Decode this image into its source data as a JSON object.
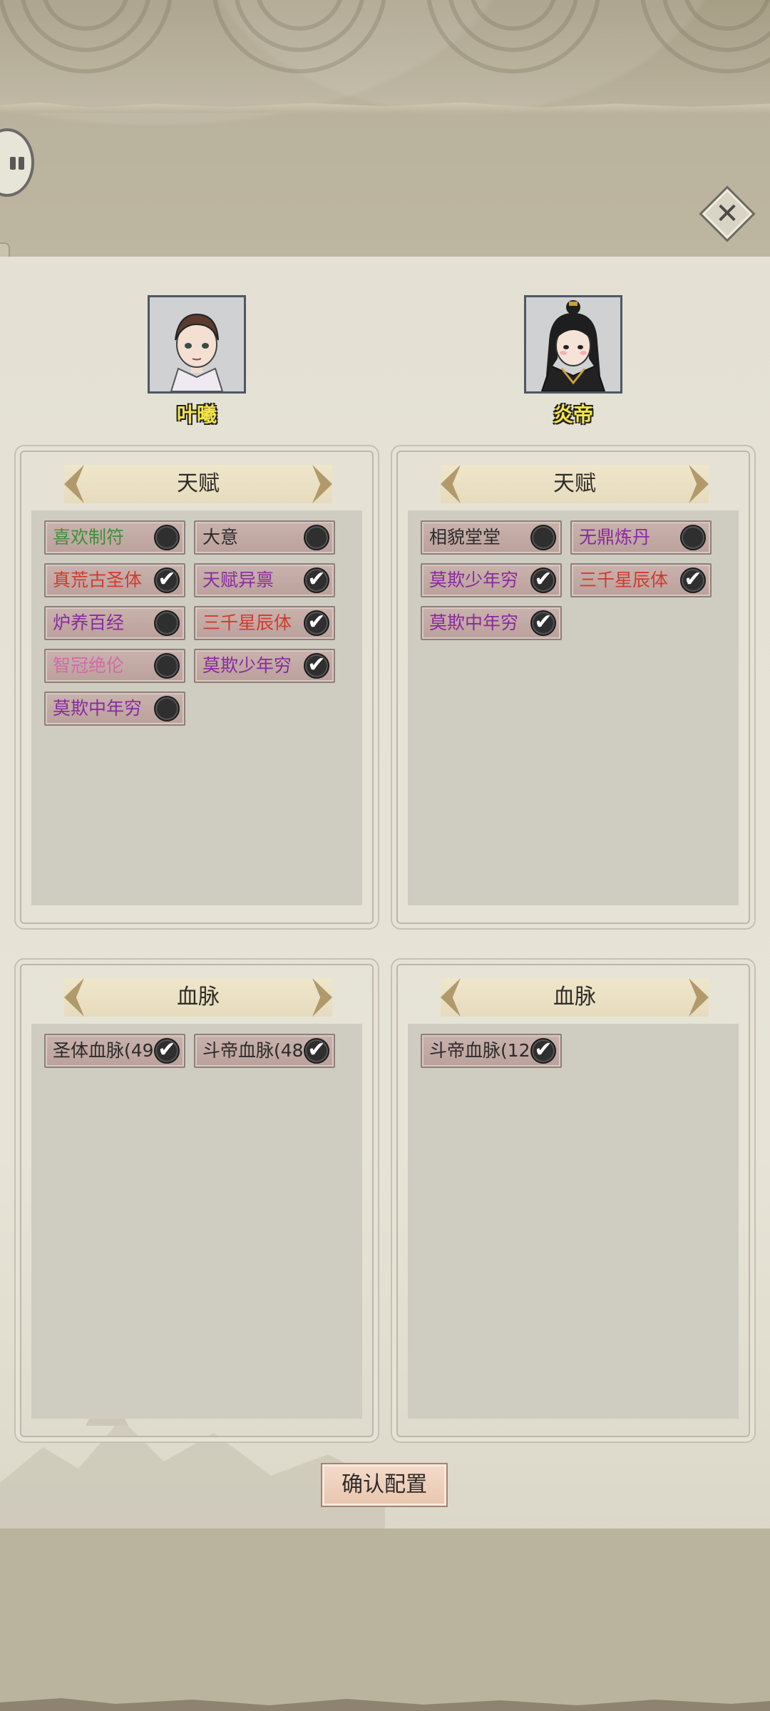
{
  "characters": [
    {
      "name": "叶曦"
    },
    {
      "name": "炎帝"
    }
  ],
  "sections": {
    "talent_title": "天赋",
    "bloodline_title": "血脉"
  },
  "left_talents": [
    {
      "label": "喜欢制符",
      "color": "#3f8f3a",
      "checked": false
    },
    {
      "label": "大意",
      "color": "#2b2b2b",
      "checked": false
    },
    {
      "label": "真荒古圣体",
      "color": "#d23b2f",
      "checked": true
    },
    {
      "label": "天赋异禀",
      "color": "#8a2aa0",
      "checked": true
    },
    {
      "label": "炉养百经",
      "color": "#8a2aa0",
      "checked": false
    },
    {
      "label": "三千星辰体",
      "color": "#d23b2f",
      "checked": true
    },
    {
      "label": "智冠绝伦",
      "color": "#d36aa8",
      "checked": false
    },
    {
      "label": "莫欺少年穷",
      "color": "#8a2aa0",
      "checked": true
    },
    {
      "label": "莫欺中年穷",
      "color": "#8a2aa0",
      "checked": false
    }
  ],
  "right_talents": [
    {
      "label": "相貌堂堂",
      "color": "#2b2b2b",
      "checked": false
    },
    {
      "label": "无鼎炼丹",
      "color": "#8a2aa0",
      "checked": false
    },
    {
      "label": "莫欺少年穷",
      "color": "#8a2aa0",
      "checked": true
    },
    {
      "label": "三千星辰体",
      "color": "#d23b2f",
      "checked": true
    },
    {
      "label": "莫欺中年穷",
      "color": "#8a2aa0",
      "checked": true
    }
  ],
  "left_bloodlines": [
    {
      "label": "圣体血脉(49",
      "color": "#2b2b2b",
      "checked": true
    },
    {
      "label": "斗帝血脉(48",
      "color": "#2b2b2b",
      "checked": true
    }
  ],
  "right_bloodlines": [
    {
      "label": "斗帝血脉(12",
      "color": "#2b2b2b",
      "checked": true
    }
  ],
  "confirm_label": "确认配置",
  "icons": {
    "close": "close-icon",
    "pause": "pause-icon",
    "check": "✔"
  }
}
